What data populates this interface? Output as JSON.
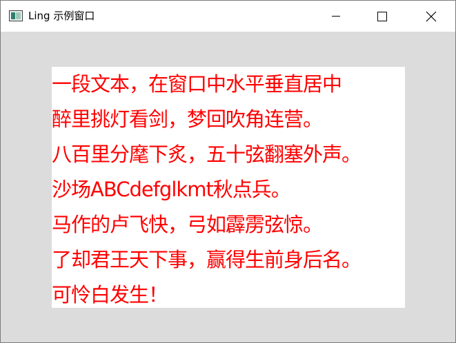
{
  "window": {
    "title": "Ling 示例窗口",
    "icon": "app-window-icon",
    "controls": {
      "minimize_icon": "minimize-icon",
      "maximize_icon": "maximize-icon",
      "close_icon": "close-icon"
    }
  },
  "content": {
    "text_color": "#ff0000",
    "background": "#ffffff",
    "lines": [
      "一段文本，在窗口中水平垂直居中",
      "醉里挑灯看剑，梦回吹角连营。",
      "八百里分麾下炙，五十弦翻塞外声。",
      "沙场ABCdefglkmt秋点兵。",
      "马作的卢飞快，弓如霹雳弦惊。",
      "了却君王天下事，赢得生前身后名。",
      "可怜白发生！"
    ]
  },
  "colors": {
    "window_background": "#dcdcdc",
    "titlebar": "#ffffff",
    "text": "#ff0000"
  }
}
